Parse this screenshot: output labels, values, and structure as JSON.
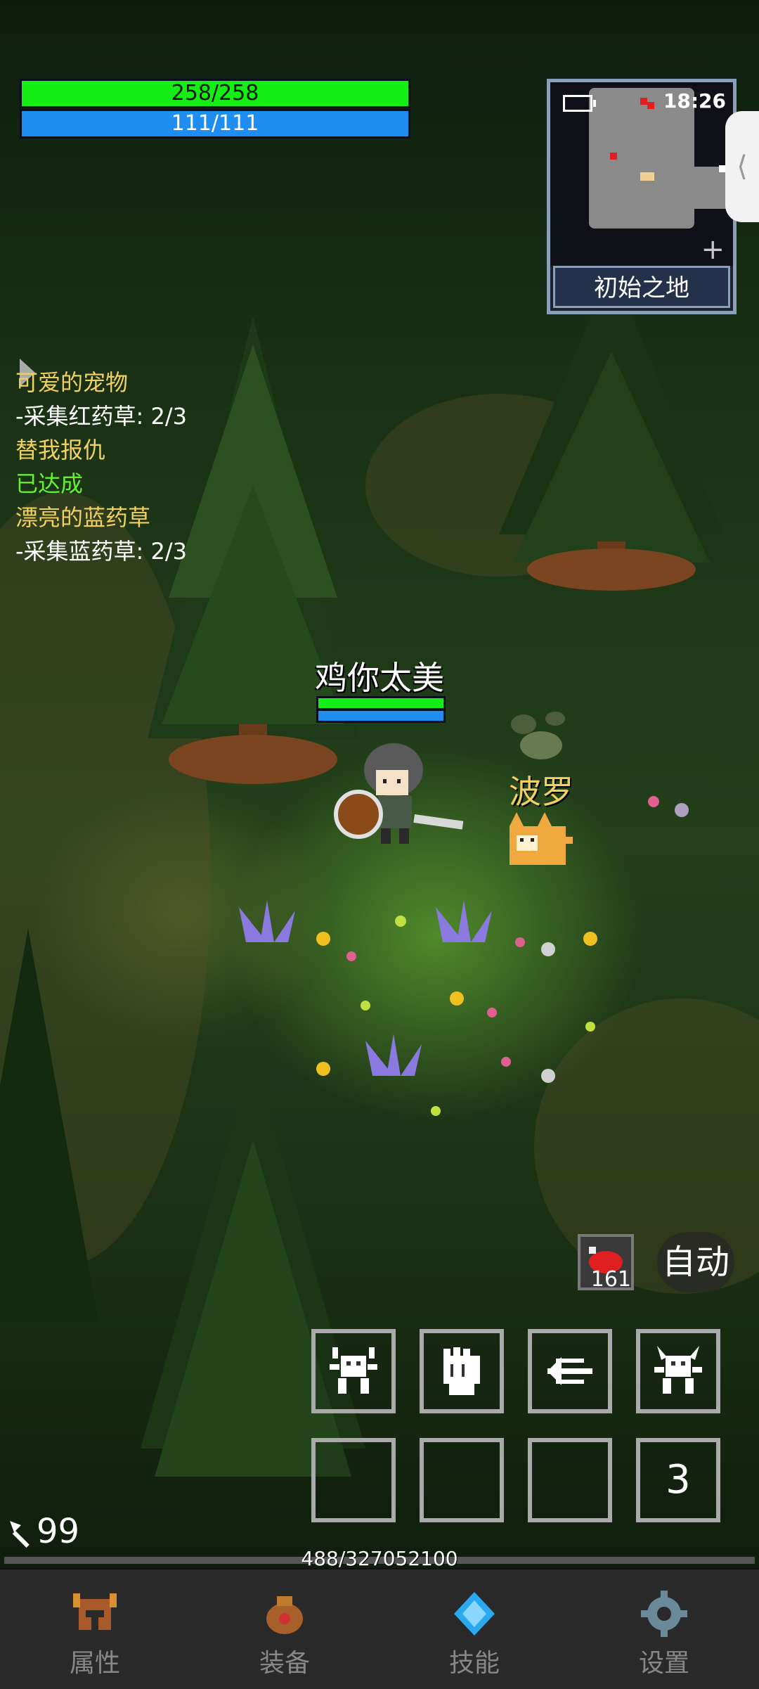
{
  "hud": {
    "hp_text": "258/258",
    "mp_text": "111/111"
  },
  "minimap": {
    "time": "18:26",
    "location": "初始之地",
    "zoom_icon": "plus-icon",
    "battery_icon": "battery-icon"
  },
  "side_tab": {
    "icon": "chevron-left-icon",
    "glyph": "⟨"
  },
  "quests": [
    {
      "title": "可爱的宠物",
      "detail": "-采集红药草: 2/3",
      "done": false
    },
    {
      "title": "替我报仇",
      "detail": "已达成",
      "done": true
    },
    {
      "title": "漂亮的蓝药草",
      "detail": "-采集蓝药草: 2/3",
      "done": false
    }
  ],
  "player": {
    "name": "鸡你太美",
    "hp_fraction": 1.0,
    "mp_fraction": 1.0
  },
  "pet": {
    "name": "波罗"
  },
  "consumable": {
    "icon": "meat-icon",
    "count": "161"
  },
  "auto_button": {
    "label": "自动"
  },
  "skill_slots": [
    {
      "icon": "beast-skill-icon",
      "filled": true
    },
    {
      "icon": "fist-skill-icon",
      "filled": true
    },
    {
      "icon": "dash-skill-icon",
      "filled": true
    },
    {
      "icon": "demon-skill-icon",
      "filled": true
    },
    {
      "filled": false
    },
    {
      "filled": false
    },
    {
      "filled": false
    },
    {
      "label": "3",
      "filled": true
    }
  ],
  "currency": {
    "icon": "sword-cursor-icon",
    "value": "99"
  },
  "experience": {
    "text": "488/327052100"
  },
  "nav": [
    {
      "label": "属性",
      "icon": "helmet-icon"
    },
    {
      "label": "装备",
      "icon": "bag-icon"
    },
    {
      "label": "技能",
      "icon": "gem-icon"
    },
    {
      "label": "设置",
      "icon": "gear-icon"
    }
  ],
  "colors": {
    "hp": "#14ee14",
    "mp": "#1f8ef0",
    "quest_title": "#f0d060",
    "quest_done": "#66ee33",
    "pet_name": "#f0d060"
  }
}
